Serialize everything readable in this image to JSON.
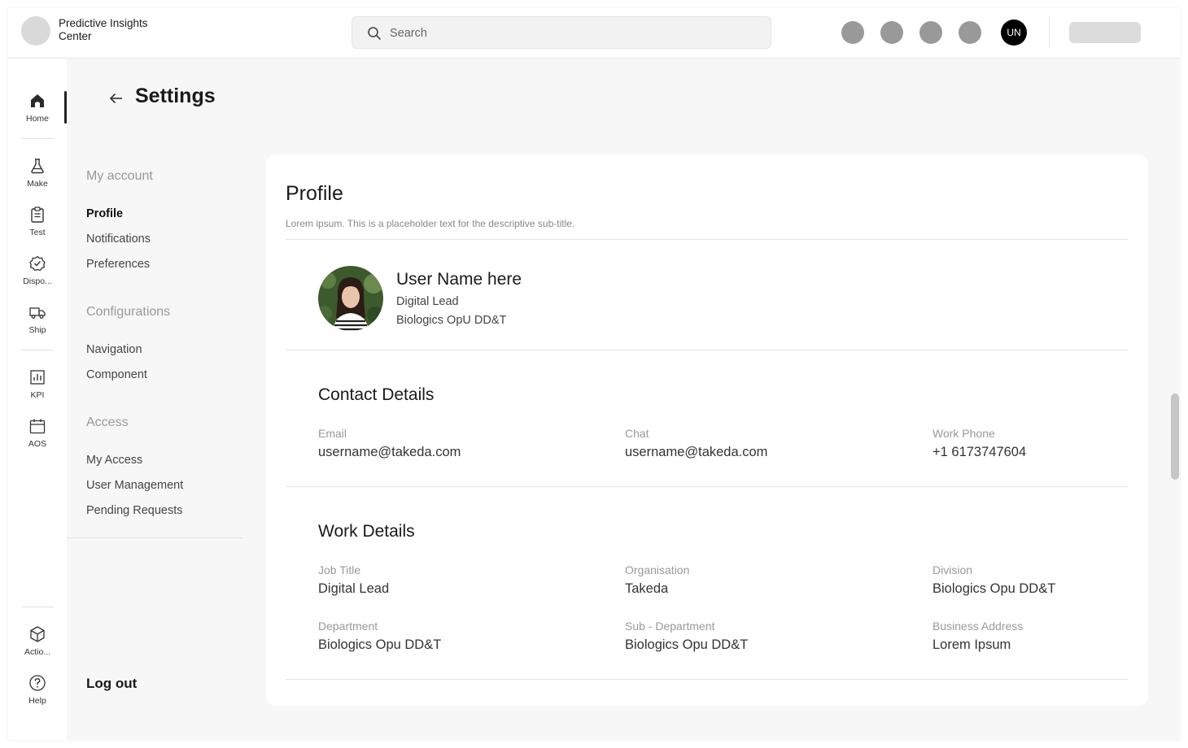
{
  "app": {
    "title": "Predictive Insights Center"
  },
  "search": {
    "placeholder": "Search"
  },
  "user": {
    "initials": "UN"
  },
  "rail": {
    "items": [
      {
        "label": "Home",
        "icon": "home-icon",
        "active": true
      },
      {
        "label": "Make",
        "icon": "flask-icon"
      },
      {
        "label": "Test",
        "icon": "clipboard-icon"
      },
      {
        "label": "Dispo...",
        "icon": "badge-check-icon"
      },
      {
        "label": "Ship",
        "icon": "truck-icon"
      },
      {
        "label": "KPI",
        "icon": "bar-chart-icon"
      },
      {
        "label": "AOS",
        "icon": "calendar-icon"
      },
      {
        "label": "Actio...",
        "icon": "cube-icon"
      },
      {
        "label": "Help",
        "icon": "help-circle-icon"
      }
    ]
  },
  "settings": {
    "title": "Settings",
    "nav": {
      "my_account": "My account",
      "profile": "Profile",
      "notifications": "Notifications",
      "preferences": "Preferences",
      "configurations": "Configurations",
      "navigation": "Navigation",
      "component": "Component",
      "access": "Access",
      "my_access": "My Access",
      "user_management": "User Management",
      "pending_requests": "Pending Requests"
    },
    "logout": "Log out"
  },
  "profile": {
    "title": "Profile",
    "subtitle": "Lorem ipsum. This is a placeholder text for the descriptive sub-title.",
    "name": "User Name here",
    "role": "Digital Lead",
    "division": "Biologics OpU DD&T",
    "contact": {
      "title": "Contact Details",
      "email_label": "Email",
      "email": "username@takeda.com",
      "chat_label": "Chat",
      "chat": "username@takeda.com",
      "phone_label": "Work Phone",
      "phone": "+1 6173747604"
    },
    "work": {
      "title": "Work Details",
      "job_title_label": "Job Title",
      "job_title": "Digital Lead",
      "organisation_label": "Organisation",
      "organisation": "Takeda",
      "division_label": "Division",
      "division": "Biologics Opu DD&T",
      "department_label": "Department",
      "department": "Biologics Opu DD&T",
      "sub_department_label": "Sub - Department",
      "sub_department": "Biologics Opu DD&T",
      "address_label": "Business Address",
      "address": "Lorem Ipsum"
    }
  },
  "colors": {
    "accent": "#000000",
    "rail_bg": "#ffffff",
    "page_bg": "#f7f7f7",
    "placeholder_grey": "#999999"
  }
}
